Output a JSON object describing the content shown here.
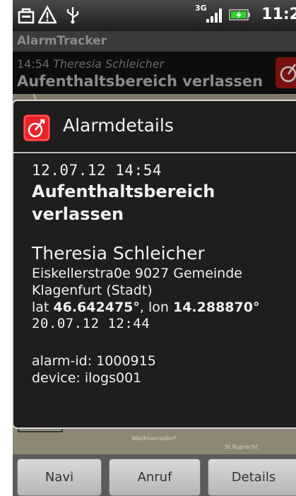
{
  "status_bar": {
    "network": "3G",
    "time": "11:2",
    "icons": [
      "bag-icon",
      "warning-icon",
      "usb-icon",
      "signal-icon",
      "battery-icon"
    ]
  },
  "app": {
    "title": "AlarmTracker"
  },
  "alarm": {
    "time": "14:54",
    "person": "Theresia Schleicher",
    "title": "Aufenthaltsbereich verlassen"
  },
  "map_labels": {
    "street": "Waidmannsdorf",
    "district": "St.Ruprecht"
  },
  "dialog": {
    "title": "Alarmdetails",
    "datetime": "12.07.12 14:54",
    "alarm_title_line1": "Aufenthaltsbereich",
    "alarm_title_line2": "verlassen",
    "name": "Theresia Schleicher",
    "address_line1": "Eiskellerstra0e 9027 Gemeinde",
    "address_line2": "Klagenfurt (Stadt)",
    "lat_label": "lat ",
    "lat_value": "46.642475°",
    "lon_label": ", lon ",
    "lon_value": "14.288870°",
    "position_time": "20.07.12 12:44",
    "alarm_id": "alarm-id: 1000915",
    "device": "device: ilogs001"
  },
  "buttons": {
    "navi": "Navi",
    "call": "Anruf",
    "details": "Details"
  },
  "colors": {
    "accent_red": "#e8232a",
    "dialog_bg": "#1e1e1e",
    "map_bg": "#7f7a6a"
  }
}
